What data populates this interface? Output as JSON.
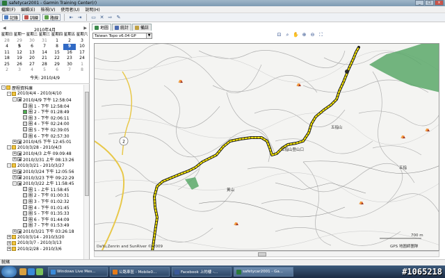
{
  "window": {
    "title": "safetycar2001 - Garmin Training Center(r)"
  },
  "menu": [
    "檔案(F)",
    "編輯(E)",
    "檢視(V)",
    "使用者(U)",
    "說明(H)"
  ],
  "toolbar": {
    "history_label": "記錄",
    "workouts_label": "訓練",
    "courses_label": "路線"
  },
  "calendar": {
    "title": "2010年4月",
    "weekdays": [
      "星期日",
      "星期一",
      "星期二",
      "星期三",
      "星期四",
      "星期五",
      "星期六"
    ],
    "weeks": [
      [
        "28",
        "29",
        "30",
        "31",
        "1",
        "2",
        "3"
      ],
      [
        "4",
        "5",
        "6",
        "7",
        "8",
        "9",
        "10"
      ],
      [
        "11",
        "12",
        "13",
        "14",
        "15",
        "16",
        "17"
      ],
      [
        "18",
        "19",
        "20",
        "21",
        "22",
        "23",
        "24"
      ],
      [
        "25",
        "26",
        "27",
        "28",
        "29",
        "30",
        "1"
      ],
      [
        "2",
        "3",
        "4",
        "5",
        "6",
        "7",
        "8"
      ]
    ],
    "today": "今天: 2010/4/9"
  },
  "tree": [
    {
      "label": "歷程資料庫",
      "level": 0,
      "icon": "folder",
      "toggle": "-"
    },
    {
      "label": "2010/4/4 - 2010/4/10",
      "level": 1,
      "icon": "folder",
      "toggle": "-"
    },
    {
      "label": "2010/4/9 下午 12:58:04",
      "level": 2,
      "icon": "act",
      "toggle": "-"
    },
    {
      "label": "圈 1 - 下午 12:58:04",
      "level": 3,
      "icon": "lap"
    },
    {
      "label": "圈 2 - 下午 01:28:49",
      "level": 3,
      "icon": "lap",
      "highlight": true
    },
    {
      "label": "圈 3 - 下午 02:06:11",
      "level": 3,
      "icon": "lap"
    },
    {
      "label": "圈 4 - 下午 02:24:00",
      "level": 3,
      "icon": "lap"
    },
    {
      "label": "圈 5 - 下午 02:39:05",
      "level": 3,
      "icon": "lap"
    },
    {
      "label": "圈 6 - 下午 02:57:30",
      "level": 3,
      "icon": "lap"
    },
    {
      "label": "2010/4/5 下午 12:45:01",
      "level": 2,
      "icon": "act",
      "toggle": "+"
    },
    {
      "label": "2010/3/28 - 2010/4/3",
      "level": 1,
      "icon": "folder",
      "toggle": "-"
    },
    {
      "label": "2010/4/3 上午 09:09:48",
      "level": 2,
      "icon": "act",
      "toggle": "+"
    },
    {
      "label": "2010/3/31 上午 08:13:26",
      "level": 2,
      "icon": "act",
      "toggle": "+"
    },
    {
      "label": "2010/3/21 - 2010/3/27",
      "level": 1,
      "icon": "folder",
      "toggle": "-"
    },
    {
      "label": "2010/3/24 下午 12:05:56",
      "level": 2,
      "icon": "act",
      "toggle": "+"
    },
    {
      "label": "2010/3/23 下午 09:22:29",
      "level": 2,
      "icon": "act",
      "toggle": "+"
    },
    {
      "label": "2010/3/22 上午 11:58:45",
      "level": 2,
      "icon": "act",
      "toggle": "-"
    },
    {
      "label": "圈 1 - 上午 11:58:45",
      "level": 3,
      "icon": "lap"
    },
    {
      "label": "圈 2 - 下午 01:00:31",
      "level": 3,
      "icon": "lap"
    },
    {
      "label": "圈 3 - 下午 01:02:32",
      "level": 3,
      "icon": "lap"
    },
    {
      "label": "圈 4 - 下午 01:01:45",
      "level": 3,
      "icon": "lap"
    },
    {
      "label": "圈 5 - 下午 01:35:33",
      "level": 3,
      "icon": "lap"
    },
    {
      "label": "圈 6 - 下午 01:44:09",
      "level": 3,
      "icon": "lap"
    },
    {
      "label": "圈 7 - 下午 01:53:49",
      "level": 3,
      "icon": "lap"
    },
    {
      "label": "2010/3/21 下午 03:26:18",
      "level": 2,
      "icon": "act",
      "toggle": "+"
    },
    {
      "label": "2010/3/14 - 2010/3/20",
      "level": 1,
      "icon": "folder",
      "toggle": "+"
    },
    {
      "label": "2010/3/7 - 2010/3/13",
      "level": 1,
      "icon": "folder",
      "toggle": "+"
    },
    {
      "label": "2010/2/28 - 2010/3/6",
      "level": 1,
      "icon": "folder",
      "toggle": "+"
    }
  ],
  "tabs": [
    "地圖",
    "統計",
    "備註"
  ],
  "map": {
    "selected_map": "Taiwan Topo v6.04 GP",
    "copyright": "DaYu,Zenrin and SunRiver © 2009",
    "scale": "700 m",
    "credit": "GPS 地圖師團隊",
    "labels": [
      "五指山登山口",
      "五指山",
      "五指",
      "黃山"
    ],
    "track_color": "#f2e100",
    "road_color": "#e8c84a"
  },
  "status": {
    "text": "就緒"
  },
  "taskbar": {
    "items": [
      {
        "label": "Windows Live Mes...",
        "color": "#3b8ad8"
      },
      {
        "label": "公路車區 - Mobile0...",
        "color": "#e47b1a"
      },
      {
        "label": "Facebook 上的樓 -...",
        "color": "#3b5998"
      },
      {
        "label": "safetycar2001 - Ga...",
        "color": "#2a7a3a",
        "active": true
      }
    ]
  },
  "watermark": "#1065218"
}
